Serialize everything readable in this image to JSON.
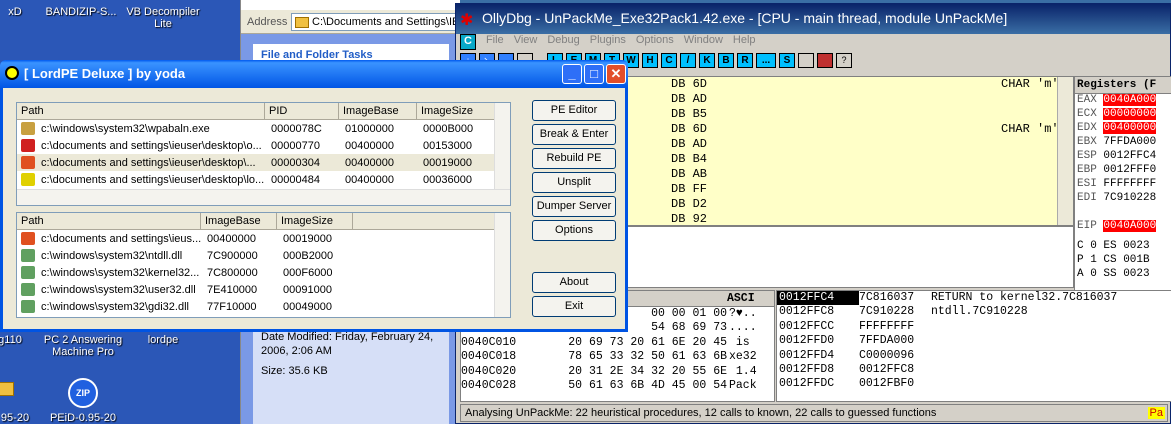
{
  "desktop": {
    "icons": [
      {
        "label": "BANDIZIP-S..."
      },
      {
        "label": "VB Decompiler Lite"
      },
      {
        "label": "PC 2 Answering Machine Pro"
      },
      {
        "label": "lordpe"
      },
      {
        "label": "PEiD-0.95-20"
      },
      {
        "label": "xD"
      },
      {
        "label": "g110"
      },
      {
        "label": "95-20"
      }
    ]
  },
  "explorer": {
    "address_label": "Address",
    "address_value": "C:\\Documents and Settings\\IE",
    "task_header": "File and Folder Tasks",
    "date_modified": "Date Modified: Friday, February 24, 2006, 2:06 AM",
    "size": "Size: 35.6 KB"
  },
  "olly": {
    "title": "OllyDbg - UnPackMe_Exe32Pack1.42.exe - [CPU - main thread, module UnPackMe]",
    "menu": [
      "File",
      "View",
      "Debug",
      "Plugins",
      "Options",
      "Window",
      "Help"
    ],
    "toolbar_letters": [
      "L",
      "E",
      "M",
      "T",
      "W",
      "H",
      "C",
      "/",
      "K",
      "B",
      "R",
      "...",
      "S"
    ],
    "cpu_lines": [
      {
        "code": "DB 6D",
        "comment": "CHAR 'm'"
      },
      {
        "code": "DB AD",
        "comment": ""
      },
      {
        "code": "DB B5",
        "comment": ""
      },
      {
        "code": "DB 6D",
        "comment": "CHAR 'm'"
      },
      {
        "code": "DB AD",
        "comment": ""
      },
      {
        "code": "DB B4",
        "comment": ""
      },
      {
        "code": "DB AB",
        "comment": ""
      },
      {
        "code": "DB FF",
        "comment": ""
      },
      {
        "code": "DB D2",
        "comment": ""
      },
      {
        "code": "DB 92",
        "comment": ""
      }
    ],
    "registers_header": "Registers (F",
    "registers": [
      {
        "name": "EAX",
        "value": "0040A000",
        "highlight": true
      },
      {
        "name": "ECX",
        "value": "00000000",
        "highlight": true
      },
      {
        "name": "EDX",
        "value": "00400000",
        "highlight": true
      },
      {
        "name": "EBX",
        "value": "7FFDA000",
        "highlight": false
      },
      {
        "name": "ESP",
        "value": "0012FFC4",
        "highlight": false
      },
      {
        "name": "EBP",
        "value": "0012FFF0",
        "highlight": false
      },
      {
        "name": "ESI",
        "value": "FFFFFFFF",
        "highlight": false
      },
      {
        "name": "EDI",
        "value": "7C910228",
        "highlight": false
      },
      {
        "name": "",
        "value": "",
        "highlight": false
      },
      {
        "name": "EIP",
        "value": "0040A000",
        "highlight": true
      }
    ],
    "flags": [
      "C 0  ES 0023",
      "P 1  CS 001B",
      "A 0  SS 0023"
    ],
    "dump_header_ascii": "ASCI",
    "dump_lines": [
      {
        "addr": "",
        "hex": "00 00 01 00",
        "ascii": "?♥.."
      },
      {
        "addr": "",
        "hex": "54 68 69 73",
        "ascii": "...."
      },
      {
        "addr": "0040C010",
        "hex": "20 69 73 20 61 6E 20 45",
        "ascii": " is "
      },
      {
        "addr": "0040C018",
        "hex": "78 65 33 32 50 61 63 6B",
        "ascii": "xe32"
      },
      {
        "addr": "0040C020",
        "hex": "20 31 2E 34 32 20 55 6E",
        "ascii": " 1.4"
      },
      {
        "addr": "0040C028",
        "hex": "50 61 63 6B 4D 45 00 54",
        "ascii": "Pack"
      }
    ],
    "stack_lines": [
      {
        "addr": "0012FFC4",
        "val": "7C816037",
        "comment": "RETURN to kernel32.7C816037",
        "sel": true
      },
      {
        "addr": "0012FFC8",
        "val": "7C910228",
        "comment": "ntdll.7C910228",
        "sel": false
      },
      {
        "addr": "0012FFCC",
        "val": "FFFFFFFF",
        "comment": "",
        "sel": false
      },
      {
        "addr": "0012FFD0",
        "val": "7FFDA000",
        "comment": "",
        "sel": false
      },
      {
        "addr": "0012FFD4",
        "val": "C0000096",
        "comment": "",
        "sel": false
      },
      {
        "addr": "0012FFD8",
        "val": "0012FFC8",
        "comment": "",
        "sel": false
      },
      {
        "addr": "0012FFDC",
        "val": "0012FBF0",
        "comment": "",
        "sel": false
      }
    ],
    "status": "Analysing UnPackMe: 22 heuristical procedures, 12 calls to known, 22 calls to guessed functions",
    "status_right": "Pa"
  },
  "lordpe": {
    "title": "[ LordPE Deluxe ] by yoda",
    "proc_headers": [
      "Path",
      "PID",
      "ImageBase",
      "ImageSize"
    ],
    "processes": [
      {
        "path": "c:\\windows\\system32\\wpabaln.exe",
        "pid": "0000078C",
        "base": "01000000",
        "size": "0000B000",
        "icon": "#c8a040",
        "sel": false
      },
      {
        "path": "c:\\documents and settings\\ieuser\\desktop\\o...",
        "pid": "00000770",
        "base": "00400000",
        "size": "00153000",
        "icon": "#d02020",
        "sel": false
      },
      {
        "path": "c:\\documents and settings\\ieuser\\desktop\\...",
        "pid": "00000304",
        "base": "00400000",
        "size": "00019000",
        "icon": "#e05020",
        "sel": true
      },
      {
        "path": "c:\\documents and settings\\ieuser\\desktop\\lo...",
        "pid": "00000484",
        "base": "00400000",
        "size": "00036000",
        "icon": "#e0d000",
        "sel": false
      }
    ],
    "mod_headers": [
      "Path",
      "ImageBase",
      "ImageSize"
    ],
    "modules": [
      {
        "path": "c:\\documents and settings\\ieus...",
        "base": "00400000",
        "size": "00019000",
        "icon": "#e05020"
      },
      {
        "path": "c:\\windows\\system32\\ntdll.dll",
        "base": "7C900000",
        "size": "000B2000",
        "icon": "#60a060"
      },
      {
        "path": "c:\\windows\\system32\\kernel32...",
        "base": "7C800000",
        "size": "000F6000",
        "icon": "#60a060"
      },
      {
        "path": "c:\\windows\\system32\\user32.dll",
        "base": "7E410000",
        "size": "00091000",
        "icon": "#60a060"
      },
      {
        "path": "c:\\windows\\system32\\gdi32.dll",
        "base": "77F10000",
        "size": "00049000",
        "icon": "#60a060"
      }
    ],
    "buttons": {
      "pe_editor": "PE Editor",
      "break_enter": "Break & Enter",
      "rebuild_pe": "Rebuild PE",
      "unsplit": "Unsplit",
      "dumper_server": "Dumper Server",
      "options": "Options",
      "about": "About",
      "exit": "Exit"
    }
  }
}
